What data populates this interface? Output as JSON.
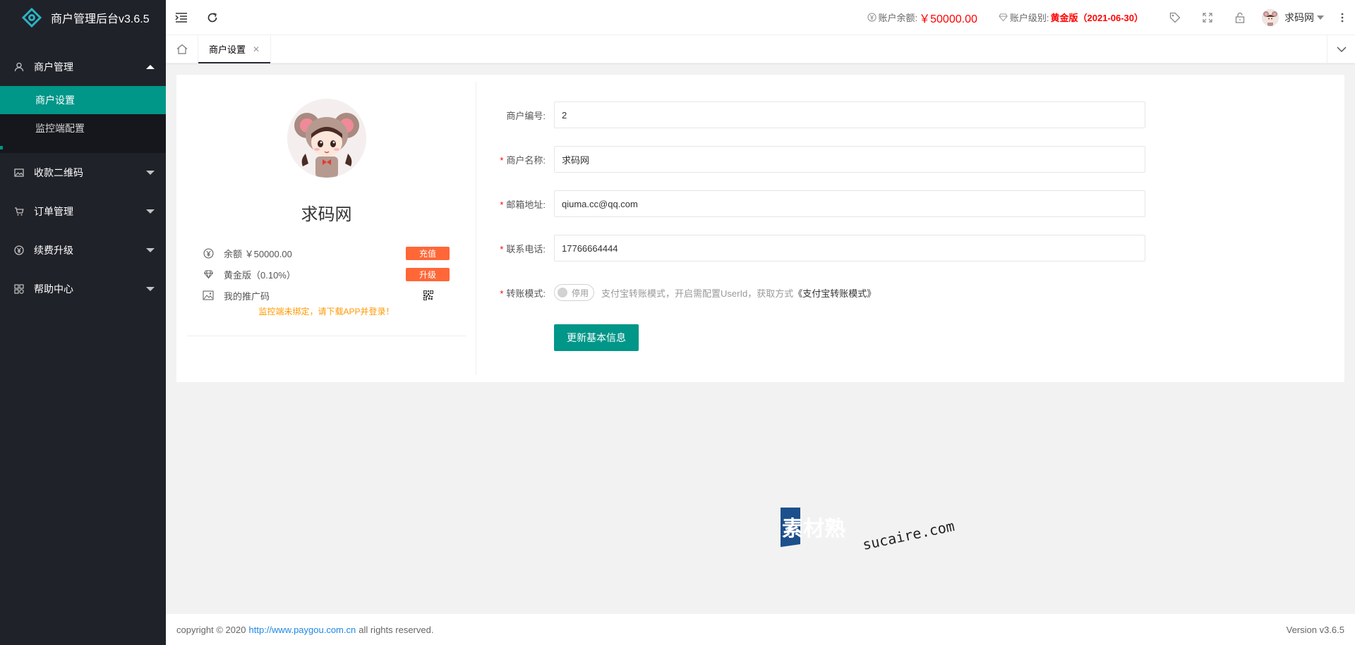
{
  "app": {
    "title": "商户管理后台v3.6.5"
  },
  "sidebar": {
    "groups": [
      {
        "label": "商户管理",
        "icon": "user-icon",
        "expanded": true,
        "children": [
          {
            "label": "商户设置",
            "active": true
          },
          {
            "label": "监控端配置",
            "active": false
          }
        ]
      },
      {
        "label": "收款二维码",
        "icon": "image-icon"
      },
      {
        "label": "订单管理",
        "icon": "cart-icon"
      },
      {
        "label": "续费升级",
        "icon": "yen-circle-icon"
      },
      {
        "label": "帮助中心",
        "icon": "apps-icon"
      }
    ]
  },
  "header": {
    "balance_label": "账户余额:",
    "balance_value": "￥50000.00",
    "level_label": "账户级别:",
    "level_value": "黄金版（2021-06-30）",
    "user_name": "求码网"
  },
  "tabs": [
    {
      "label": "商户设置",
      "closable": true
    }
  ],
  "profile": {
    "name": "求码网",
    "balance_text": "余额 ￥50000.00",
    "recharge_button": "充值",
    "level_text": "黄金版（0.10%）",
    "upgrade_button": "升级",
    "promo_label": "我的推广码",
    "warning": "监控端未绑定，请下载APP并登录！"
  },
  "form": {
    "merchant_id_label": "商户编号:",
    "merchant_id_value": "2",
    "merchant_name_label": "商户名称:",
    "merchant_name_value": "求码网",
    "email_label": "邮箱地址:",
    "email_value": "qiuma.cc@qq.com",
    "phone_label": "联系电话:",
    "phone_value": "17766664444",
    "transfer_label": "转账模式:",
    "transfer_toggle": "停用",
    "transfer_hint": "支付宝转账模式，开启需配置UserId，获取方式",
    "transfer_link": "《支付宝转账模式》",
    "submit_label": "更新基本信息"
  },
  "watermark": {
    "cn": "素材熟",
    "en": "sucaire.com"
  },
  "footer": {
    "copyright_prefix": "copyright © 2020",
    "link": "http://www.paygou.com.cn",
    "copyright_suffix": "all rights reserved.",
    "version": "Version v3.6.5"
  },
  "colors": {
    "sidebar_bg": "#20222a",
    "accent": "#009688",
    "danger": "#ff5722",
    "price": "#ff0000"
  }
}
